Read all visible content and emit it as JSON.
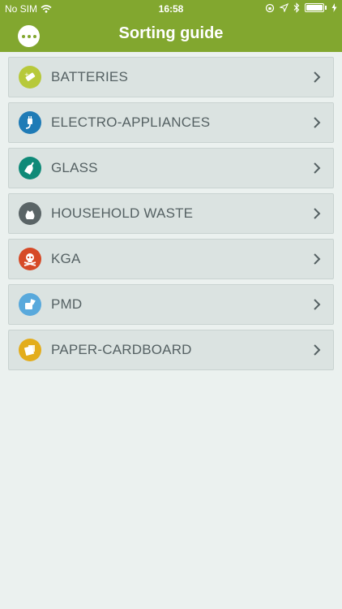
{
  "status": {
    "carrier": "No SIM",
    "time": "16:58"
  },
  "header": {
    "title": "Sorting guide"
  },
  "categories": [
    {
      "label": "BATTERIES",
      "icon": "battery-icon",
      "color": "#b7c93a"
    },
    {
      "label": "ELECTRO-APPLIANCES",
      "icon": "plug-icon",
      "color": "#1f7bb6"
    },
    {
      "label": "GLASS",
      "icon": "bottle-icon",
      "color": "#0f8a78"
    },
    {
      "label": "HOUSEHOLD WASTE",
      "icon": "trash-bag-icon",
      "color": "#5a6466"
    },
    {
      "label": "KGA",
      "icon": "skull-icon",
      "color": "#d64a27"
    },
    {
      "label": "PMD",
      "icon": "pmd-icon",
      "color": "#59a9dc"
    },
    {
      "label": "PAPER-CARDBOARD",
      "icon": "paper-icon",
      "color": "#e3ad1c"
    }
  ],
  "colors": {
    "header": "#82a72f",
    "background": "#ebf1ef",
    "item": "#dbe3e1",
    "text": "#556163"
  }
}
